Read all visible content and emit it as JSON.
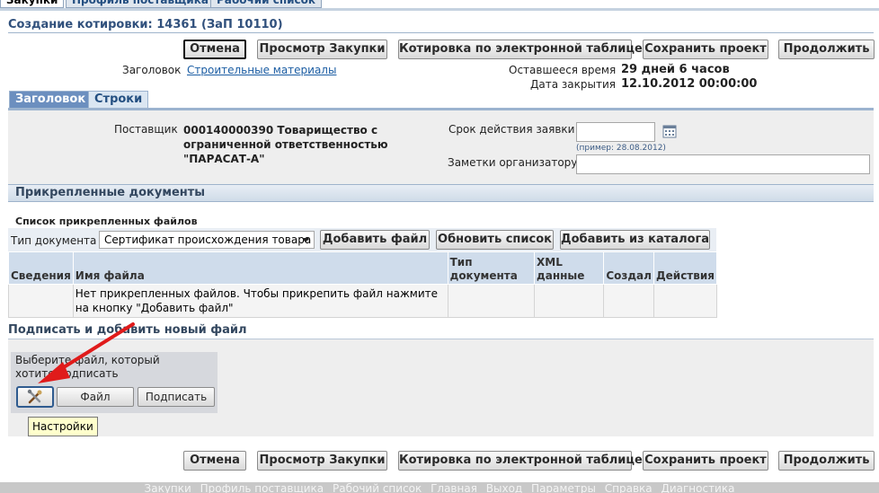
{
  "top_tabs": [
    "Закупки",
    "Профиль поставщика",
    "Рабочий список"
  ],
  "page_title": "Создание котировки: 14361 (ЗаП 10110)",
  "actions": {
    "cancel": "Отмена",
    "view_rfq": "Просмотр Закупки",
    "quote_by_spreadsheet": "Котировка по электронной таблице",
    "save_draft": "Сохранить проект",
    "continue": "Продолжить"
  },
  "header_info": {
    "heading_label": "Заголовок",
    "heading_value": "Строительные материалы",
    "time_left_label": "Оставшееся время",
    "time_left_value": "29 дней 6 часов",
    "close_date_label": "Дата закрытия",
    "close_date_value": "12.10.2012 00:00:00"
  },
  "subtabs": [
    "Заголовок",
    "Строки"
  ],
  "form": {
    "supplier_label": "Поставщик",
    "supplier_value": "000140000390 Товарищество с ограниченной ответственностью \"ПАРАСАТ-А\"",
    "validity_label": "Срок действия заявки",
    "validity_value": "",
    "validity_hint": "(пример: 28.08.2012)",
    "notes_label": "Заметки организатору",
    "notes_value": ""
  },
  "attachments": {
    "section_title": "Прикрепленные документы",
    "list_title": "Список прикрепленных файлов",
    "doc_type_label": "Тип документа",
    "doc_type_selected": "Сертификат происхождения товара",
    "add_file": "Добавить файл",
    "refresh_list": "Обновить список",
    "add_from_catalog": "Добавить из каталога",
    "columns": [
      "Сведения",
      "Имя файла",
      "Тип документа",
      "XML данные",
      "Создал",
      "Действия"
    ],
    "empty_message": "Нет прикрепленных файлов. Чтобы прикрепить файл нажмите на кнопку \"Добавить файл\""
  },
  "sign": {
    "section_title": "Подписать и добавить новый файл",
    "instruction": "Выберите файл, который хотите подписать",
    "file_button": "Файл",
    "sign_button": "Подписать",
    "settings_tooltip": "Настройки"
  },
  "footer_links": [
    "Закупки",
    "Профиль поставщика",
    "Рабочий список",
    "Главная",
    "Выход",
    "Параметры",
    "Справка",
    "Диагностика"
  ],
  "colors": {
    "title_blue": "#30507c",
    "active_subtab": "#6c8fbf",
    "annotation_arrow": "#e01b1b",
    "tooltip_bg": "#ffffcc"
  }
}
